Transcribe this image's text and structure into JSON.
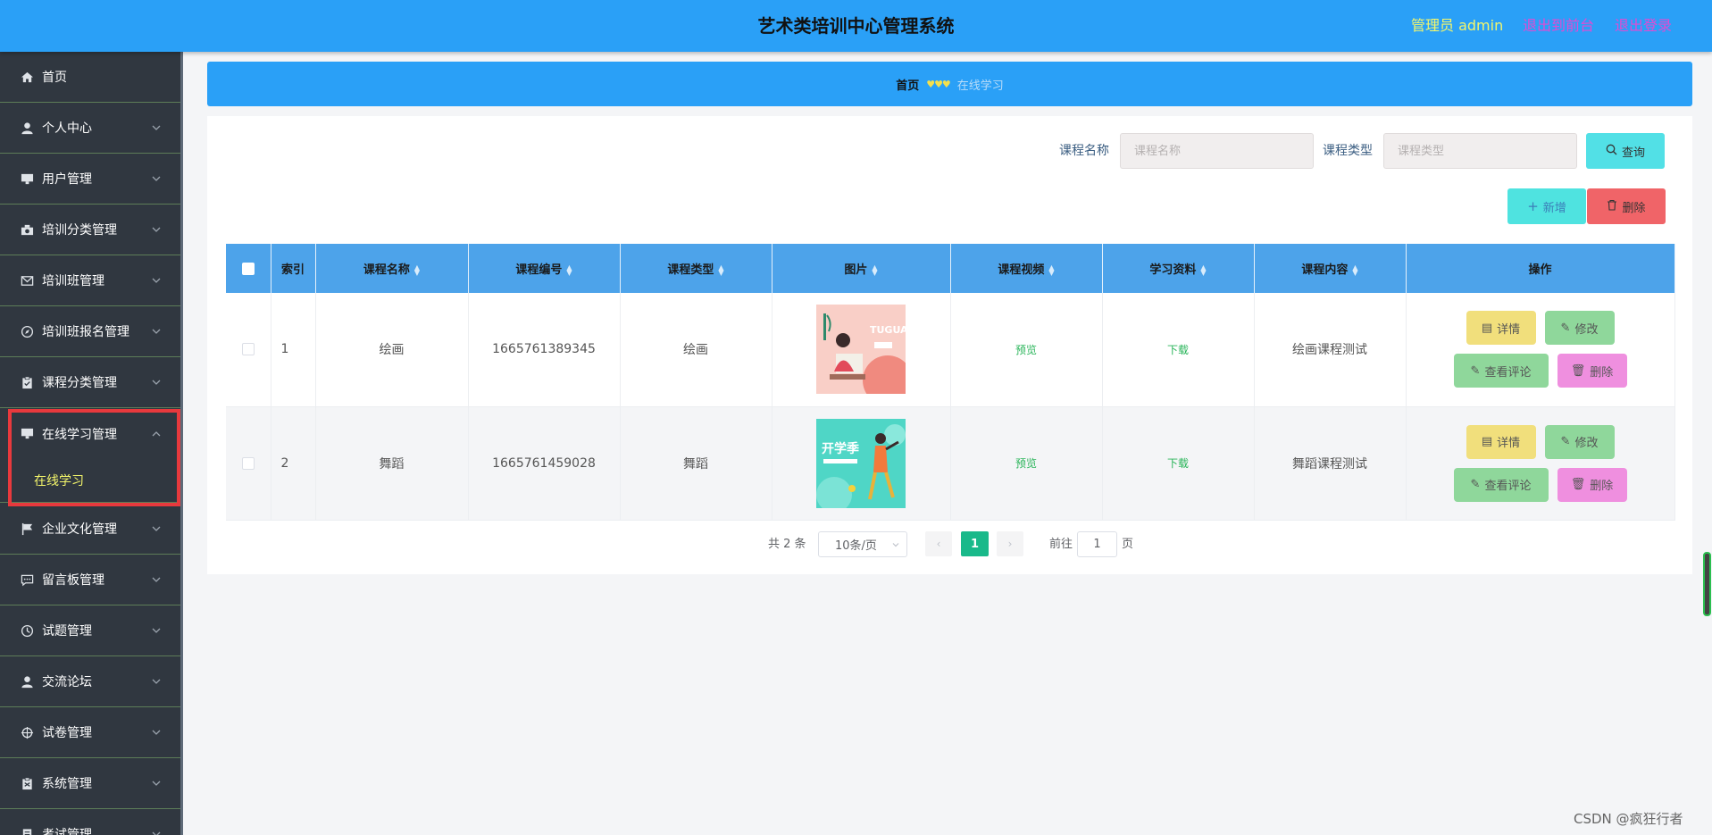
{
  "header": {
    "title": "艺术类培训中心管理系统",
    "admin_label": "管理员 admin",
    "back_to_front": "退出到前台",
    "logout": "退出登录"
  },
  "sidebar": {
    "items": [
      {
        "label": "首页",
        "icon": "home-icon"
      },
      {
        "label": "个人中心",
        "icon": "user-icon"
      },
      {
        "label": "用户管理",
        "icon": "monitor-icon"
      },
      {
        "label": "培训分类管理",
        "icon": "camera-icon"
      },
      {
        "label": "培训班管理",
        "icon": "mail-icon"
      },
      {
        "label": "培训班报名管理",
        "icon": "compass-icon"
      },
      {
        "label": "课程分类管理",
        "icon": "clipboard-icon"
      },
      {
        "label": "在线学习管理",
        "icon": "monitor-icon"
      },
      {
        "label": "企业文化管理",
        "icon": "flag-icon"
      },
      {
        "label": "留言板管理",
        "icon": "chat-icon"
      },
      {
        "label": "试题管理",
        "icon": "clock-icon"
      },
      {
        "label": "交流论坛",
        "icon": "user-icon"
      },
      {
        "label": "试卷管理",
        "icon": "target-icon"
      },
      {
        "label": "系统管理",
        "icon": "clipboard-icon"
      },
      {
        "label": "考试管理",
        "icon": "document-icon"
      }
    ],
    "sub_item": "在线学习"
  },
  "breadcrumb": {
    "home": "首页",
    "separator": "♥♥♥",
    "current": "在线学习"
  },
  "search": {
    "course_name_label": "课程名称",
    "course_name_placeholder": "课程名称",
    "course_type_label": "课程类型",
    "course_type_placeholder": "课程类型",
    "query_button": "查询"
  },
  "actions": {
    "add_button": "新增",
    "delete_button": "删除"
  },
  "table": {
    "headers": [
      "索引",
      "课程名称",
      "课程编号",
      "课程类型",
      "图片",
      "课程视频",
      "学习资料",
      "课程内容",
      "操作"
    ],
    "rows": [
      {
        "index": "1",
        "name": "绘画",
        "code": "1665761389345",
        "type": "绘画",
        "image_text": "TUGUAI",
        "video": "预览",
        "material": "下载",
        "content": "绘画课程测试"
      },
      {
        "index": "2",
        "name": "舞蹈",
        "code": "1665761459028",
        "type": "舞蹈",
        "image_text": "开学季",
        "video": "预览",
        "material": "下载",
        "content": "舞蹈课程测试"
      }
    ],
    "op_labels": {
      "detail": "详情",
      "edit": "修改",
      "view_comments": "查看评论",
      "delete": "删除"
    }
  },
  "pagination": {
    "total": "共 2 条",
    "page_size": "10条/页",
    "current_page": "1",
    "goto_label": "前往",
    "goto_value": "1",
    "page_suffix": "页"
  },
  "watermark": "CSDN @疯狂行者",
  "colors": {
    "header_bg": "#2aa0f7",
    "sidebar_bg": "#303740",
    "active_text": "#f4f66b",
    "logout_link": "#e14bd3",
    "table_header": "#4da3ea",
    "highlight_box": "#e8393d"
  }
}
